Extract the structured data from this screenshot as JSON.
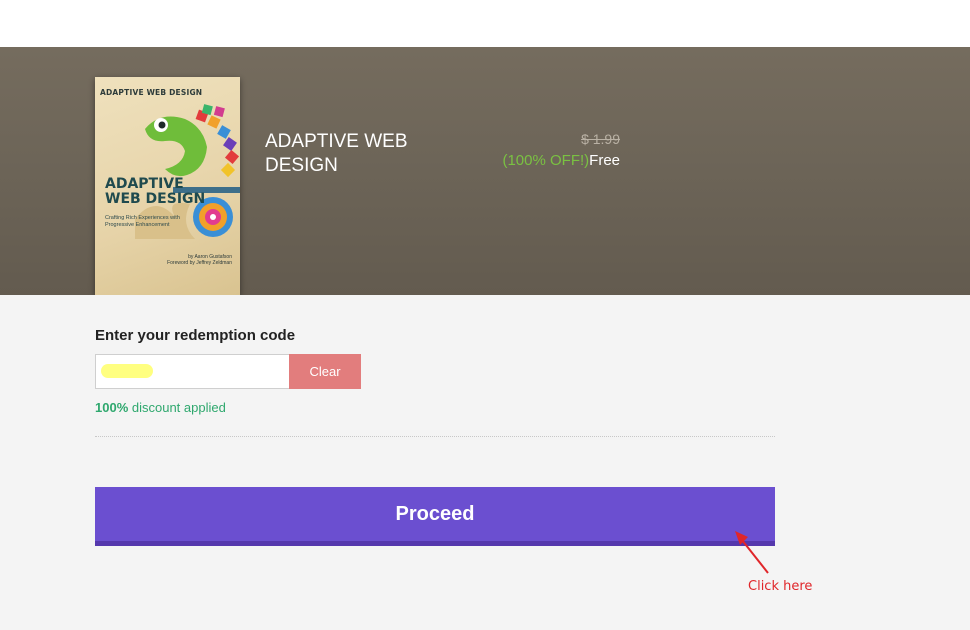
{
  "product": {
    "title": "ADAPTIVE WEB DESIGN",
    "original_price": "$ 1.99",
    "discount_label": "(100% OFF!)",
    "final_price": "Free",
    "cover": {
      "top_label": "ADAPTIVE WEB DESIGN",
      "title_line1": "ADAPTIVE",
      "title_line2": "WEB DESIGN",
      "subtitle": "Crafting Rich Experiences with Progressive Enhancement",
      "author": "by Aaron Gustafson",
      "foreword": "Foreword by Jeffrey Zeldman"
    }
  },
  "redemption": {
    "label": "Enter your redemption code",
    "input_value": "",
    "clear_label": "Clear",
    "discount_percent": "100%",
    "discount_text": " discount applied"
  },
  "proceed": {
    "label": "Proceed"
  },
  "annotation": {
    "text": "Click here",
    "color": "#e0262a"
  },
  "colors": {
    "proceed_button": "#6b4fd0",
    "clear_button": "#e27d7d",
    "discount_green": "#2fa86e",
    "off_green": "#7ac142"
  }
}
